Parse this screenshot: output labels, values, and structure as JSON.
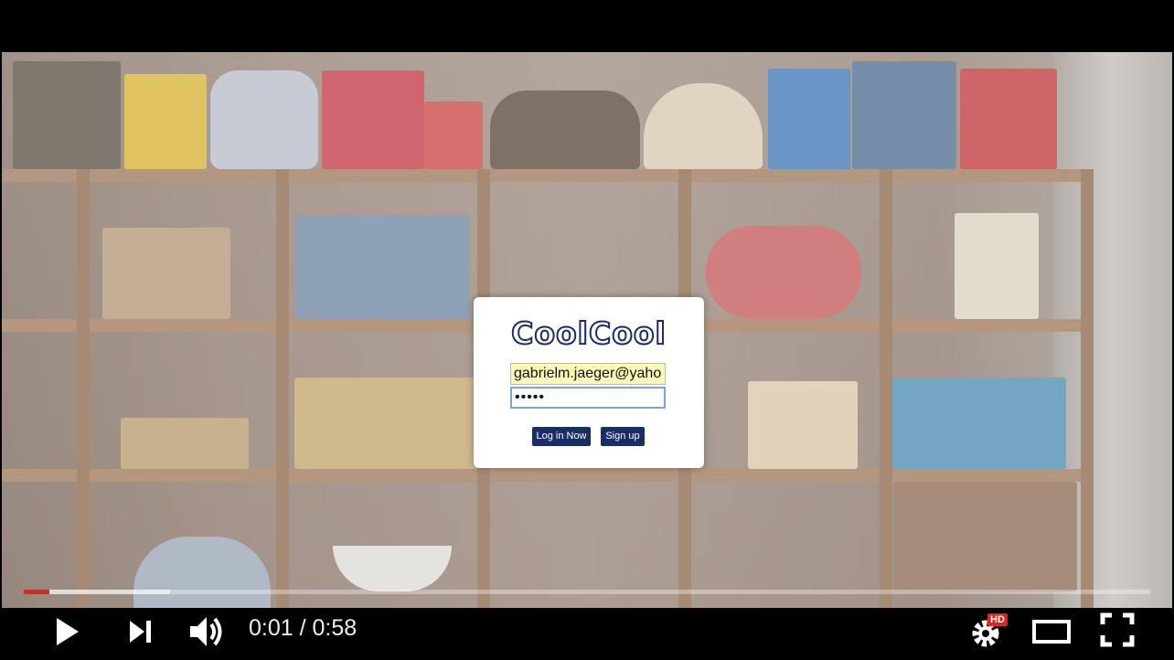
{
  "login": {
    "logo": "CoolCool",
    "email_value": "gabrielm.jaeger@yahoo",
    "password_value": "•••••",
    "login_button": "Log in Now",
    "signup_button": "Sign up"
  },
  "player": {
    "current_time": "0:01",
    "separator": " / ",
    "duration": "0:58",
    "progress": 0.023,
    "buffered": 0.13,
    "hd_badge": "HD",
    "colors": {
      "progress_played": "#e52222",
      "button_bg": "#1b2d66"
    },
    "icons": [
      "play-icon",
      "next-icon",
      "volume-icon",
      "settings-icon",
      "theater-mode-icon",
      "fullscreen-icon"
    ]
  }
}
